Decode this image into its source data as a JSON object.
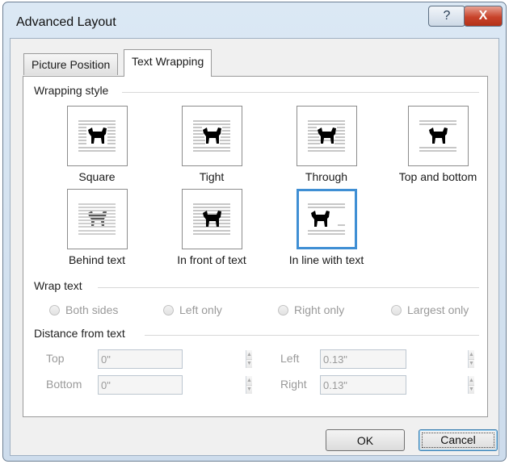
{
  "window": {
    "title": "Advanced Layout",
    "help_glyph": "?",
    "close_glyph": "X"
  },
  "tabs": [
    {
      "label": "Picture Position",
      "active": false
    },
    {
      "label": "Text Wrapping",
      "active": true
    }
  ],
  "wrapping_style": {
    "label": "Wrapping style",
    "options": [
      {
        "label": "Square",
        "icon": "wrap-square-icon",
        "selected": false
      },
      {
        "label": "Tight",
        "icon": "wrap-tight-icon",
        "selected": false
      },
      {
        "label": "Through",
        "icon": "wrap-through-icon",
        "selected": false
      },
      {
        "label": "Top and bottom",
        "icon": "wrap-top-bottom-icon",
        "selected": false
      },
      {
        "label": "Behind text",
        "icon": "wrap-behind-text-icon",
        "selected": false
      },
      {
        "label": "In front of text",
        "icon": "wrap-in-front-icon",
        "selected": false
      },
      {
        "label": "In line with text",
        "icon": "wrap-inline-icon",
        "selected": true
      }
    ]
  },
  "wrap_text": {
    "label": "Wrap text",
    "options": [
      {
        "label": "Both sides",
        "enabled": false
      },
      {
        "label": "Left only",
        "enabled": false
      },
      {
        "label": "Right only",
        "enabled": false
      },
      {
        "label": "Largest only",
        "enabled": false
      }
    ]
  },
  "distance": {
    "label": "Distance from text",
    "top": {
      "label": "Top",
      "value": "0\""
    },
    "bottom": {
      "label": "Bottom",
      "value": "0\""
    },
    "left": {
      "label": "Left",
      "value": "0.13\""
    },
    "right": {
      "label": "Right",
      "value": "0.13\""
    }
  },
  "buttons": {
    "ok": "OK",
    "cancel": "Cancel"
  },
  "colors": {
    "selection_border": "#3f8fd4",
    "disabled_text": "#9a9a9a",
    "text_lines": "#c7c7c7",
    "dog": "#000000"
  }
}
